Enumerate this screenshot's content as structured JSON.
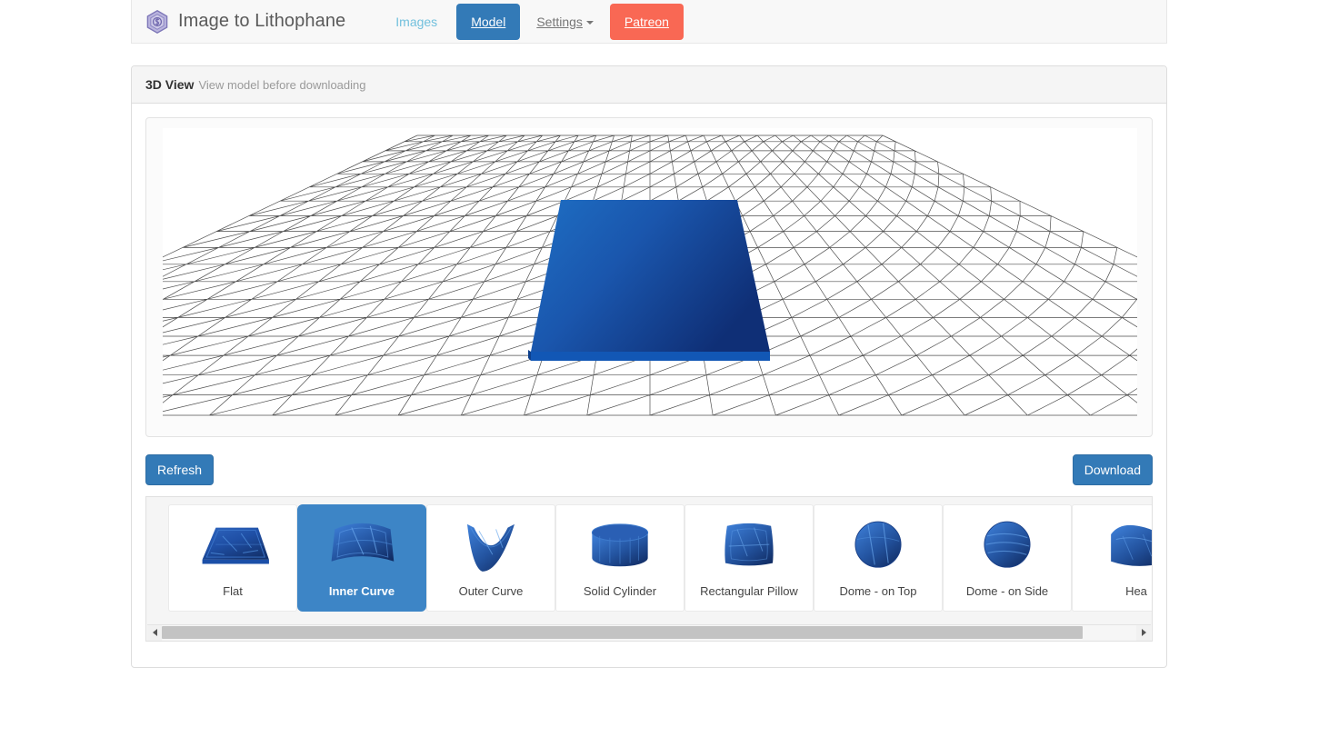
{
  "navbar": {
    "brand": {
      "icon": "hexagon-cube-logo-icon",
      "text": "Image to Lithophane"
    },
    "links": [
      {
        "label": "Images",
        "name": "nav-link-images",
        "style": "link"
      },
      {
        "label": "Model",
        "name": "nav-link-model",
        "style": "active-button"
      },
      {
        "label": "Settings",
        "name": "nav-link-settings",
        "style": "dropdown"
      },
      {
        "label": "Patreon",
        "name": "nav-link-patreon",
        "style": "patreon-button"
      }
    ],
    "colors": {
      "model_button": "#337ab7",
      "patreon_button": "#f96854",
      "link": "#5bb3d6",
      "background": "#f8f8f8"
    }
  },
  "panel": {
    "title": "3D View",
    "subtitle": "View model before downloading"
  },
  "viewport": {
    "model_name": "flat-lithophane-slab",
    "model_color_top": "#1e4f9c",
    "model_color_edge": "#1b64c4",
    "grid_color": "#4a4a4a",
    "background": "#ffffff"
  },
  "actions": {
    "refresh_label": "Refresh",
    "download_label": "Download"
  },
  "shapes": {
    "selected": "Inner Curve",
    "items": [
      {
        "label": "Flat",
        "icon": "flat-plate-thumb",
        "selected": false
      },
      {
        "label": "Inner Curve",
        "icon": "inner-curve-thumb",
        "selected": true
      },
      {
        "label": "Outer Curve",
        "icon": "outer-curve-thumb",
        "selected": false
      },
      {
        "label": "Solid Cylinder",
        "icon": "solid-cylinder-thumb",
        "selected": false
      },
      {
        "label": "Rectangular Pillow",
        "icon": "rectangular-pillow-thumb",
        "selected": false
      },
      {
        "label": "Dome - on Top",
        "icon": "dome-on-top-thumb",
        "selected": false
      },
      {
        "label": "Dome - on Side",
        "icon": "dome-on-side-thumb",
        "selected": false
      },
      {
        "label": "Hea",
        "icon": "heart-thumb",
        "selected": false
      }
    ],
    "scrollbar": {
      "left_arrow": "scroll-left-arrow-icon",
      "right_arrow": "scroll-right-arrow-icon",
      "thumb_fraction": "0.94"
    }
  }
}
